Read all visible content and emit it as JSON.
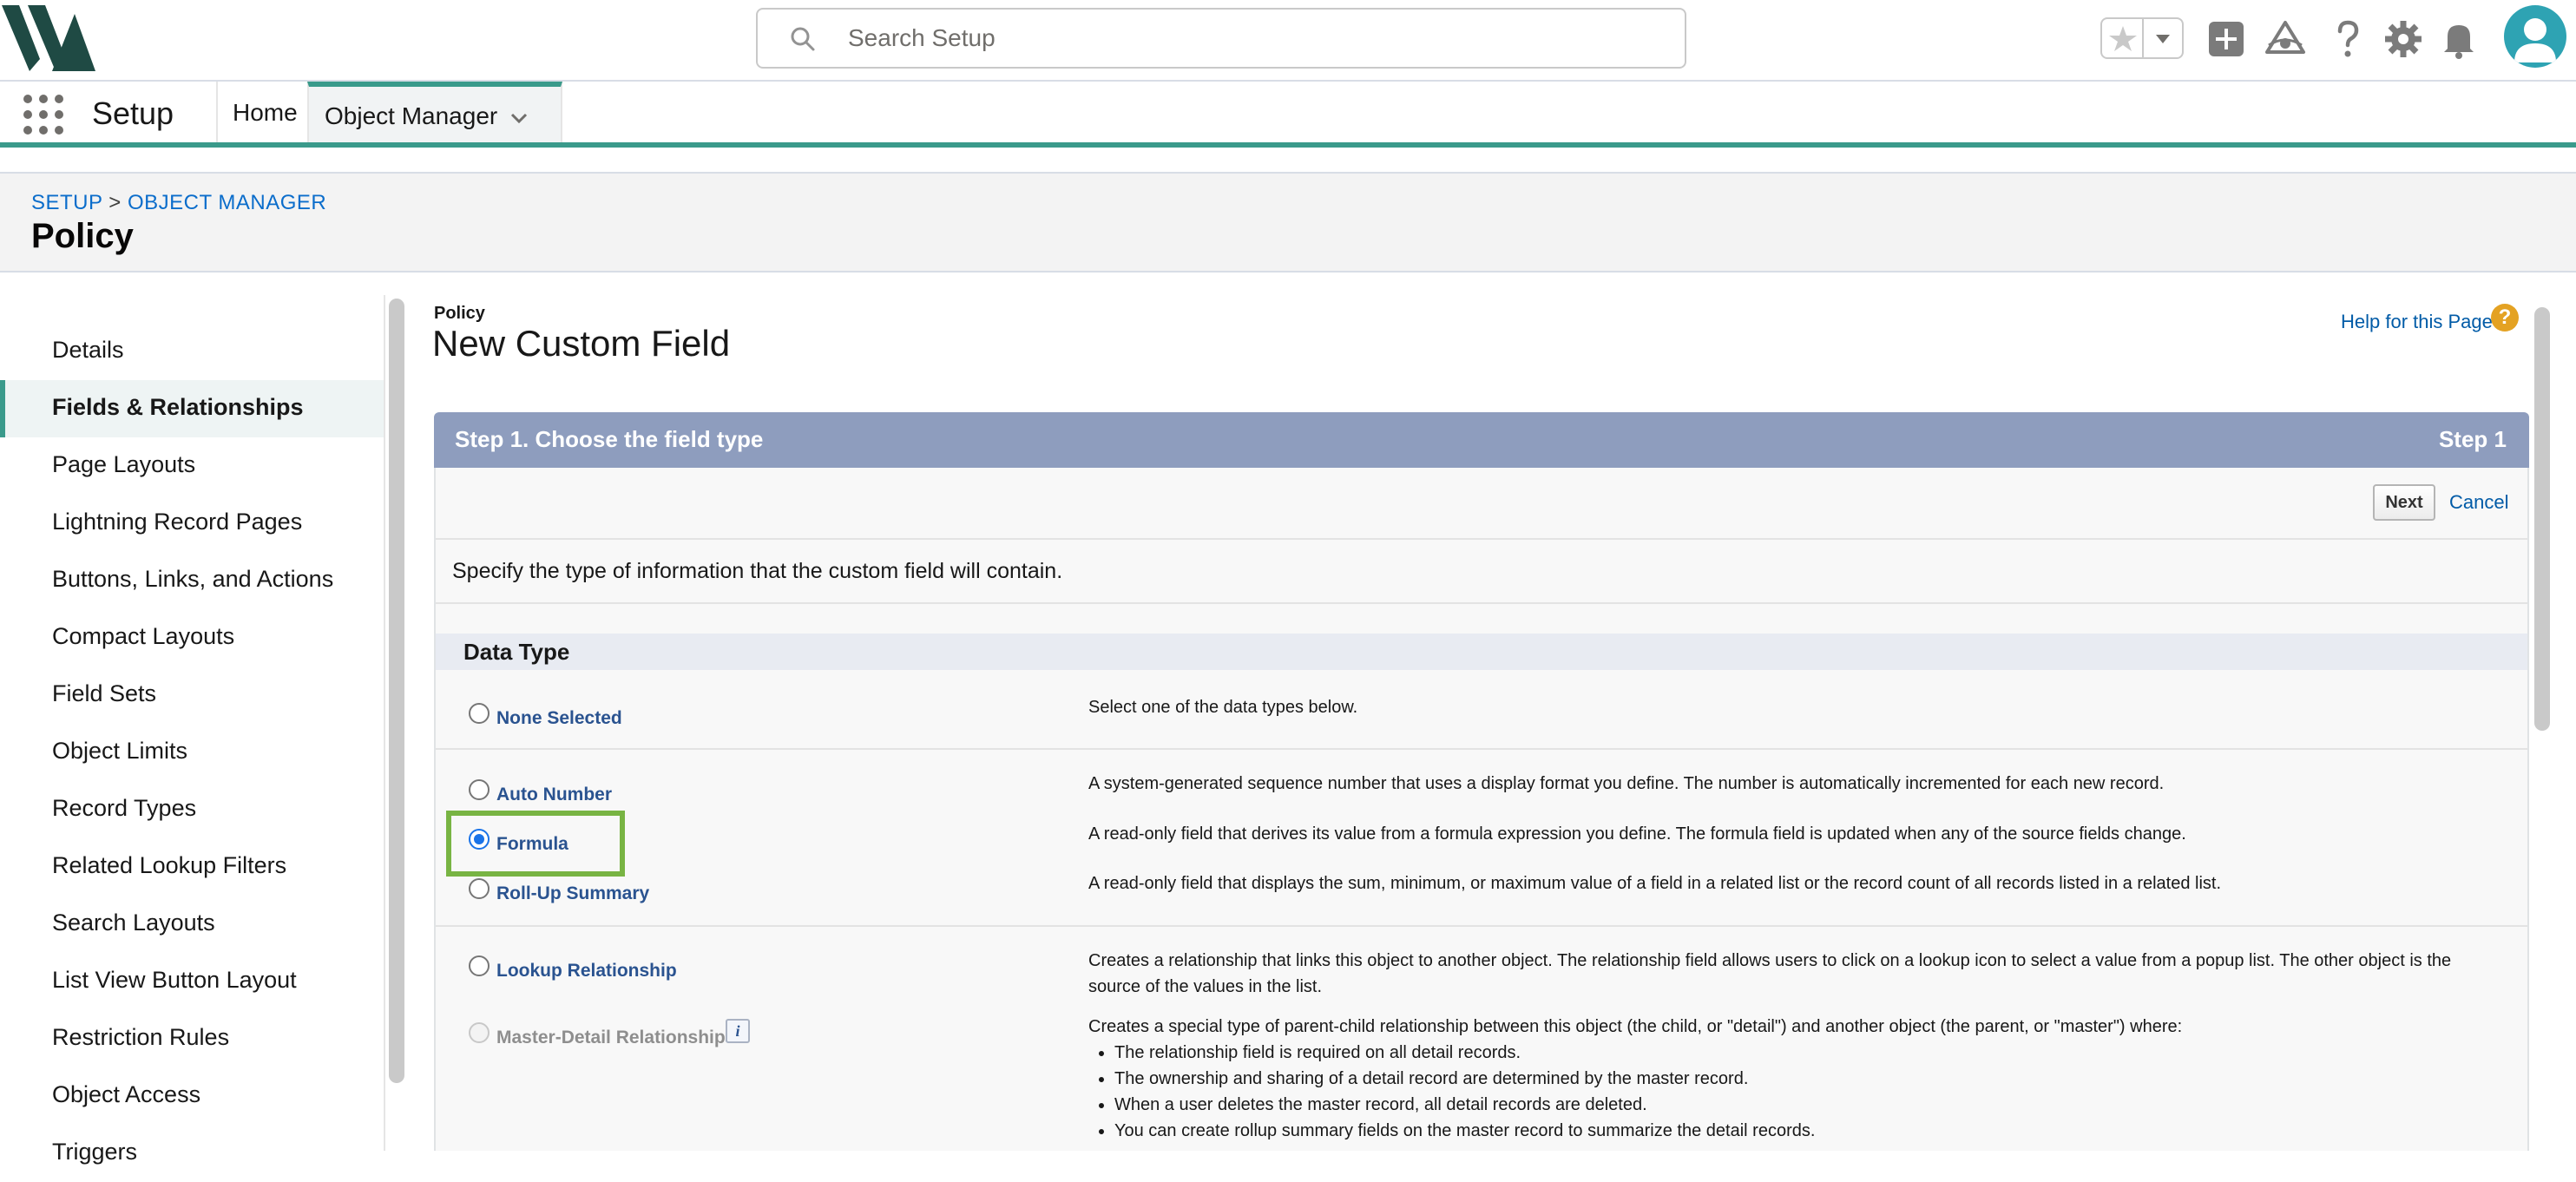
{
  "header": {
    "search_placeholder": "Search Setup",
    "icons": [
      "logo-icon",
      "search-icon",
      "star-icon",
      "chevron-down-icon",
      "add-icon",
      "trailhead-icon",
      "help-icon",
      "gear-icon",
      "bell-icon",
      "avatar-icon"
    ]
  },
  "nav": {
    "app_name": "Setup",
    "home_label": "Home",
    "object_manager_label": "Object Manager"
  },
  "page_header": {
    "breadcrumb_setup": "SETUP",
    "breadcrumb_sep": ">",
    "breadcrumb_object_manager": "OBJECT MANAGER",
    "title": "Policy"
  },
  "sidebar": {
    "items": [
      {
        "label": "Details"
      },
      {
        "label": "Fields & Relationships"
      },
      {
        "label": "Page Layouts"
      },
      {
        "label": "Lightning Record Pages"
      },
      {
        "label": "Buttons, Links, and Actions"
      },
      {
        "label": "Compact Layouts"
      },
      {
        "label": "Field Sets"
      },
      {
        "label": "Object Limits"
      },
      {
        "label": "Record Types"
      },
      {
        "label": "Related Lookup Filters"
      },
      {
        "label": "Search Layouts"
      },
      {
        "label": "List View Button Layout"
      },
      {
        "label": "Restriction Rules"
      },
      {
        "label": "Object Access"
      },
      {
        "label": "Triggers"
      }
    ],
    "active": "Fields & Relationships"
  },
  "main": {
    "object_label": "Policy",
    "title": "New Custom Field",
    "help_link": "Help for this Page",
    "help_icon_glyph": "?",
    "step_title": "Step 1. Choose the field type",
    "step_number": "Step 1",
    "next_label": "Next",
    "cancel_label": "Cancel",
    "instructions": "Specify the type of information that the custom field will contain.",
    "data_type_header": "Data Type",
    "options": {
      "none": {
        "label": "None Selected",
        "desc": "Select one of the data types below."
      },
      "auto_number": {
        "label": "Auto Number",
        "desc": "A system-generated sequence number that uses a display format you define. The number is automatically incremented for each new record."
      },
      "formula": {
        "label": "Formula",
        "desc": "A read-only field that derives its value from a formula expression you define. The formula field is updated when any of the source fields change."
      },
      "rollup": {
        "label": "Roll-Up Summary",
        "desc": "A read-only field that displays the sum, minimum, or maximum value of a field in a related list or the record count of all records listed in a related list."
      },
      "lookup": {
        "label": "Lookup Relationship",
        "desc": "Creates a relationship that links this object to another object. The relationship field allows users to click on a lookup icon to select a value from a popup list. The other object is the source of the values in the list."
      },
      "master_detail": {
        "label": "Master-Detail Relationship",
        "info_glyph": "i",
        "desc": "Creates a special type of parent-child relationship between this object (the child, or \"detail\") and another object (the parent, or \"master\") where:",
        "bullets": [
          "The relationship field is required on all detail records.",
          "The ownership and sharing of a detail record are determined by the master record.",
          "When a user deletes the master record, all detail records are deleted.",
          "You can create rollup summary fields on the master record to summarize the detail records."
        ]
      }
    },
    "selected": "Formula"
  },
  "colors": {
    "accent_teal": "#3a9a8b",
    "step_bar": "#8e9dbe",
    "link_blue": "#015ba7",
    "highlight_green": "#78b443",
    "avatar": "#2ea3b3"
  }
}
